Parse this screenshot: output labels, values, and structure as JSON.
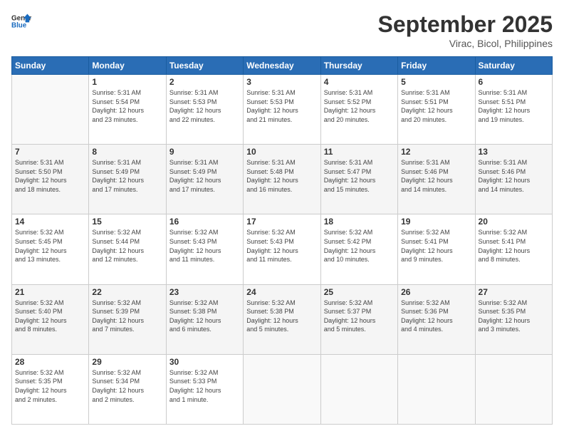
{
  "logo": {
    "line1": "General",
    "line2": "Blue"
  },
  "title": "September 2025",
  "location": "Virac, Bicol, Philippines",
  "days_header": [
    "Sunday",
    "Monday",
    "Tuesday",
    "Wednesday",
    "Thursday",
    "Friday",
    "Saturday"
  ],
  "weeks": [
    [
      {
        "day": "",
        "info": ""
      },
      {
        "day": "1",
        "info": "Sunrise: 5:31 AM\nSunset: 5:54 PM\nDaylight: 12 hours\nand 23 minutes."
      },
      {
        "day": "2",
        "info": "Sunrise: 5:31 AM\nSunset: 5:53 PM\nDaylight: 12 hours\nand 22 minutes."
      },
      {
        "day": "3",
        "info": "Sunrise: 5:31 AM\nSunset: 5:53 PM\nDaylight: 12 hours\nand 21 minutes."
      },
      {
        "day": "4",
        "info": "Sunrise: 5:31 AM\nSunset: 5:52 PM\nDaylight: 12 hours\nand 20 minutes."
      },
      {
        "day": "5",
        "info": "Sunrise: 5:31 AM\nSunset: 5:51 PM\nDaylight: 12 hours\nand 20 minutes."
      },
      {
        "day": "6",
        "info": "Sunrise: 5:31 AM\nSunset: 5:51 PM\nDaylight: 12 hours\nand 19 minutes."
      }
    ],
    [
      {
        "day": "7",
        "info": "Sunrise: 5:31 AM\nSunset: 5:50 PM\nDaylight: 12 hours\nand 18 minutes."
      },
      {
        "day": "8",
        "info": "Sunrise: 5:31 AM\nSunset: 5:49 PM\nDaylight: 12 hours\nand 17 minutes."
      },
      {
        "day": "9",
        "info": "Sunrise: 5:31 AM\nSunset: 5:49 PM\nDaylight: 12 hours\nand 17 minutes."
      },
      {
        "day": "10",
        "info": "Sunrise: 5:31 AM\nSunset: 5:48 PM\nDaylight: 12 hours\nand 16 minutes."
      },
      {
        "day": "11",
        "info": "Sunrise: 5:31 AM\nSunset: 5:47 PM\nDaylight: 12 hours\nand 15 minutes."
      },
      {
        "day": "12",
        "info": "Sunrise: 5:31 AM\nSunset: 5:46 PM\nDaylight: 12 hours\nand 14 minutes."
      },
      {
        "day": "13",
        "info": "Sunrise: 5:31 AM\nSunset: 5:46 PM\nDaylight: 12 hours\nand 14 minutes."
      }
    ],
    [
      {
        "day": "14",
        "info": "Sunrise: 5:32 AM\nSunset: 5:45 PM\nDaylight: 12 hours\nand 13 minutes."
      },
      {
        "day": "15",
        "info": "Sunrise: 5:32 AM\nSunset: 5:44 PM\nDaylight: 12 hours\nand 12 minutes."
      },
      {
        "day": "16",
        "info": "Sunrise: 5:32 AM\nSunset: 5:43 PM\nDaylight: 12 hours\nand 11 minutes."
      },
      {
        "day": "17",
        "info": "Sunrise: 5:32 AM\nSunset: 5:43 PM\nDaylight: 12 hours\nand 11 minutes."
      },
      {
        "day": "18",
        "info": "Sunrise: 5:32 AM\nSunset: 5:42 PM\nDaylight: 12 hours\nand 10 minutes."
      },
      {
        "day": "19",
        "info": "Sunrise: 5:32 AM\nSunset: 5:41 PM\nDaylight: 12 hours\nand 9 minutes."
      },
      {
        "day": "20",
        "info": "Sunrise: 5:32 AM\nSunset: 5:41 PM\nDaylight: 12 hours\nand 8 minutes."
      }
    ],
    [
      {
        "day": "21",
        "info": "Sunrise: 5:32 AM\nSunset: 5:40 PM\nDaylight: 12 hours\nand 8 minutes."
      },
      {
        "day": "22",
        "info": "Sunrise: 5:32 AM\nSunset: 5:39 PM\nDaylight: 12 hours\nand 7 minutes."
      },
      {
        "day": "23",
        "info": "Sunrise: 5:32 AM\nSunset: 5:38 PM\nDaylight: 12 hours\nand 6 minutes."
      },
      {
        "day": "24",
        "info": "Sunrise: 5:32 AM\nSunset: 5:38 PM\nDaylight: 12 hours\nand 5 minutes."
      },
      {
        "day": "25",
        "info": "Sunrise: 5:32 AM\nSunset: 5:37 PM\nDaylight: 12 hours\nand 5 minutes."
      },
      {
        "day": "26",
        "info": "Sunrise: 5:32 AM\nSunset: 5:36 PM\nDaylight: 12 hours\nand 4 minutes."
      },
      {
        "day": "27",
        "info": "Sunrise: 5:32 AM\nSunset: 5:35 PM\nDaylight: 12 hours\nand 3 minutes."
      }
    ],
    [
      {
        "day": "28",
        "info": "Sunrise: 5:32 AM\nSunset: 5:35 PM\nDaylight: 12 hours\nand 2 minutes."
      },
      {
        "day": "29",
        "info": "Sunrise: 5:32 AM\nSunset: 5:34 PM\nDaylight: 12 hours\nand 2 minutes."
      },
      {
        "day": "30",
        "info": "Sunrise: 5:32 AM\nSunset: 5:33 PM\nDaylight: 12 hours\nand 1 minute."
      },
      {
        "day": "",
        "info": ""
      },
      {
        "day": "",
        "info": ""
      },
      {
        "day": "",
        "info": ""
      },
      {
        "day": "",
        "info": ""
      }
    ]
  ]
}
